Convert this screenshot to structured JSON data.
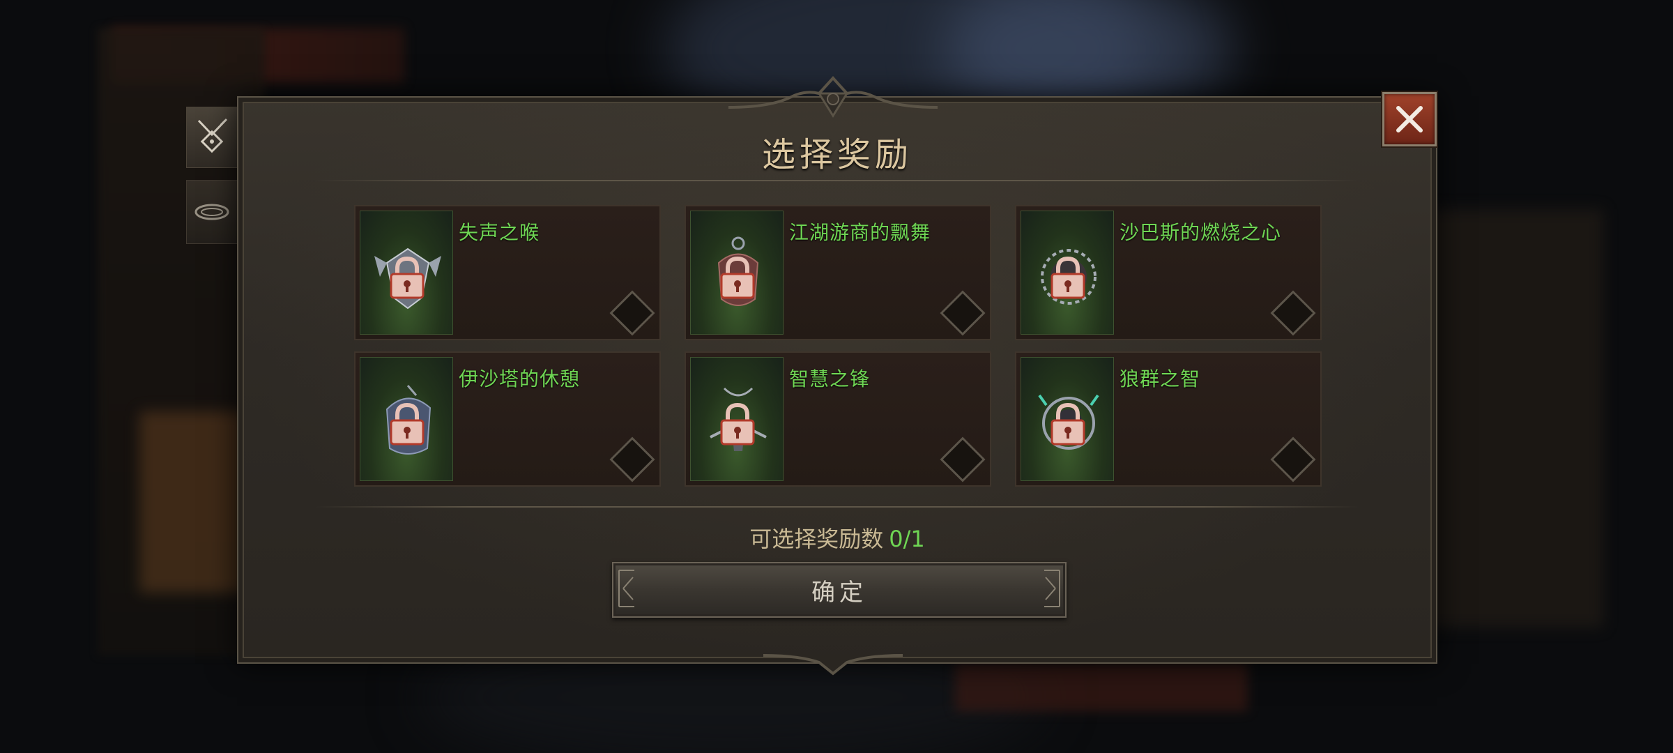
{
  "dialog": {
    "title": "选择奖励",
    "reward_count_label": "可选择奖励数",
    "reward_count_value": "0/1",
    "confirm_label": "确定"
  },
  "rewards": [
    {
      "name": "失声之喉",
      "icon": "wing-amulet-icon",
      "locked": true
    },
    {
      "name": "江湖游商的飘舞",
      "icon": "pouch-amulet-icon",
      "locked": true
    },
    {
      "name": "沙巴斯的燃烧之心",
      "icon": "thorn-heart-amulet-icon",
      "locked": true
    },
    {
      "name": "伊沙塔的休憩",
      "icon": "stone-amulet-icon",
      "locked": true
    },
    {
      "name": "智慧之锋",
      "icon": "chain-amulet-icon",
      "locked": true
    },
    {
      "name": "狼群之智",
      "icon": "ring-amulet-icon",
      "locked": true
    }
  ],
  "side_tabs": [
    {
      "icon": "amulet-icon",
      "active": true
    },
    {
      "icon": "ring-icon",
      "active": false
    }
  ],
  "colors": {
    "title": "#dcc7a0",
    "item_name_green": "#6fd654",
    "close_button": "#a0422a",
    "lock": "#e8c1b6"
  }
}
